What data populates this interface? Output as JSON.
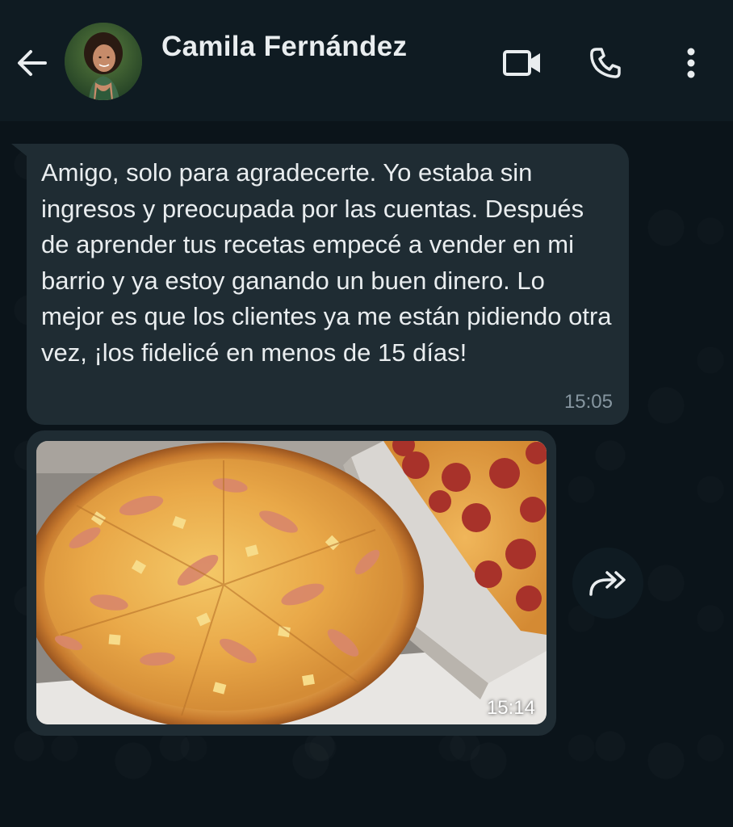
{
  "header": {
    "contact_name": "Camila Fernández",
    "icons": {
      "back": "arrow-left-icon",
      "video": "video-camera-icon",
      "call": "phone-icon",
      "menu": "more-vertical-icon"
    }
  },
  "messages": [
    {
      "type": "text",
      "text": "Amigo, solo para agradecerte. Yo estaba sin ingresos y preocupada por las cuentas. Después de aprender tus recetas empecé a vender en mi barrio y ya estoy ganando un buen dinero. Lo mejor es que los clientes ya me están pidiendo otra vez, ¡los fidelicé en menos de 15 días!",
      "time": "15:05"
    },
    {
      "type": "image",
      "image_subject": "pizza-photo",
      "time": "15:14",
      "forward_icon": "forward-icon"
    }
  ],
  "colors": {
    "background": "#0b141a",
    "header": "#0f1b22",
    "bubble": "#1f2c33",
    "text": "#e9edef",
    "time": "#8696a0"
  }
}
